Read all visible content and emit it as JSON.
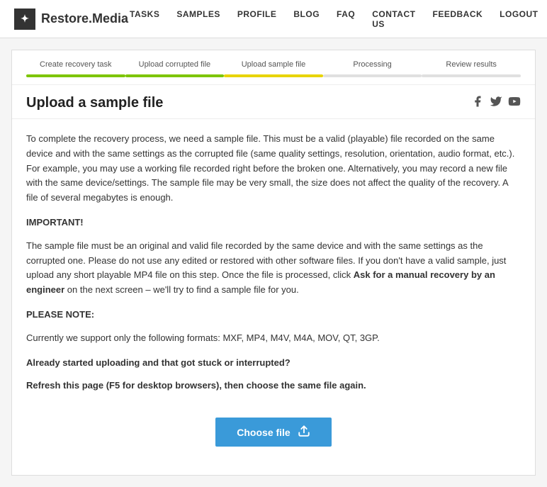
{
  "header": {
    "logo_text": "Restore.Media",
    "logo_icon": "✦",
    "nav": {
      "items": [
        {
          "label": "TASKS",
          "id": "tasks"
        },
        {
          "label": "SAMPLES",
          "id": "samples"
        },
        {
          "label": "PROFILE",
          "id": "profile"
        },
        {
          "label": "BLOG",
          "id": "blog"
        },
        {
          "label": "FAQ",
          "id": "faq"
        },
        {
          "label": "CONTACT US",
          "id": "contact-us"
        },
        {
          "label": "FEEDBACK",
          "id": "feedback"
        },
        {
          "label": "LOGOUT",
          "id": "logout"
        }
      ]
    }
  },
  "steps": [
    {
      "label": "Create recovery task",
      "bar": "green"
    },
    {
      "label": "Upload corrupted file",
      "bar": "green"
    },
    {
      "label": "Upload sample file",
      "bar": "yellow"
    },
    {
      "label": "Processing",
      "bar": "empty"
    },
    {
      "label": "Review results",
      "bar": "empty"
    }
  ],
  "page_title": "Upload a sample file",
  "social": {
    "facebook": "f",
    "twitter": "t",
    "youtube": "▶"
  },
  "content": {
    "intro": "To complete the recovery process, we need a sample file. This must be a valid (playable) file recorded on the same device and with the same settings as the corrupted file (same quality settings, resolution, orientation, audio format, etc.). For example, you may use a working file recorded right before the broken one. Alternatively, you may record a new file with the same device/settings. The sample file may be very small, the size does not affect the quality of the recovery. A file of several megabytes is enough.",
    "important_label": "IMPORTANT!",
    "important_text": "The sample file must be an original and valid file recorded by the same device and with the same settings as the corrupted one. Please do not use any edited or restored with other software files. If you don't have a valid sample, just upload any short playable MP4 file on this step. Once the file is processed, click ",
    "ask_link": "Ask for a manual recovery by an engineer",
    "important_text2": " on the next screen – we'll try to find a sample file for you.",
    "please_note_label": "PLEASE NOTE:",
    "please_note_text": "Currently we support only the following formats: MXF, MP4, M4V, M4A, MOV, QT, 3GP.",
    "stuck_bold1": "Already started uploading and that got stuck or interrupted?",
    "stuck_bold2": "Refresh this page (F5 for desktop browsers), then choose the same file again.",
    "choose_file": "Choose file"
  }
}
